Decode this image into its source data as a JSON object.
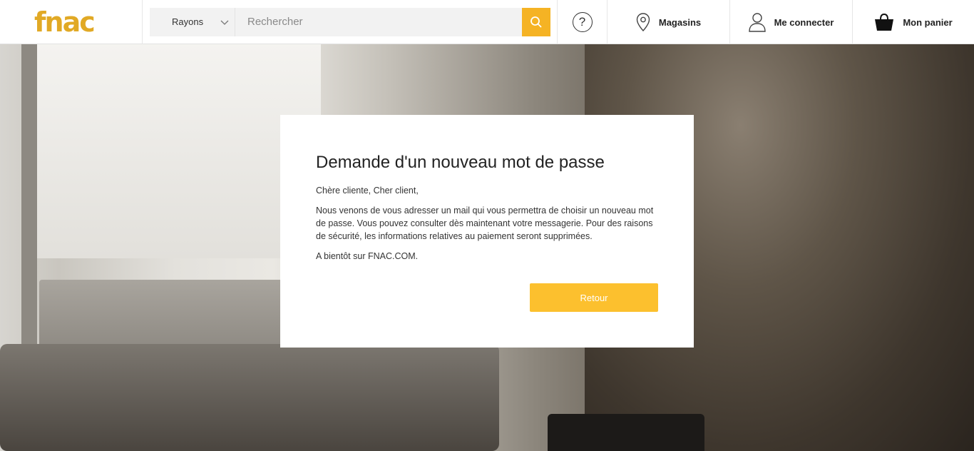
{
  "header": {
    "logo": "fnac",
    "rayons_label": "Rayons",
    "search_placeholder": "Rechercher",
    "help_symbol": "?",
    "magasins_label": "Magasins",
    "connect_label": "Me connecter",
    "cart_label": "Mon panier"
  },
  "modal": {
    "title": "Demande d'un nouveau mot de passe",
    "greeting": "Chère cliente, Cher client,",
    "body": "Nous venons de vous adresser un mail qui vous permettra de choisir un nouveau mot de passe. Vous pouvez consulter dès maintenant votre messagerie. Pour des raisons de sécurité, les informations relatives au paiement seront supprimées.",
    "closing": "A bientôt sur FNAC.COM.",
    "button_label": "Retour"
  },
  "colors": {
    "brand": "#e1a925",
    "search_button": "#f5b324",
    "primary_button": "#fcc02e"
  },
  "icons": [
    "search-icon",
    "chevron-down-icon",
    "help-icon",
    "location-pin-icon",
    "user-icon",
    "shopping-basket-icon"
  ]
}
